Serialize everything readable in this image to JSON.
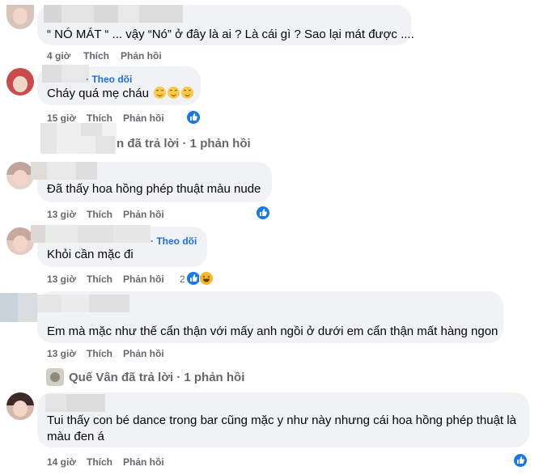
{
  "comments": [
    {
      "text": "“ NÓ MÁT “ ... vậy “Nó” ở đây là ai ? Là cái gì ? Sao lại mát được ....",
      "time": "4 giờ",
      "like": "Thích",
      "reply": "Phản hồi"
    },
    {
      "follow": "· Theo dõi",
      "text": "Cháy quá mẹ cháu",
      "time": "15 giờ",
      "like": "Thích",
      "reply": "Phản hồi",
      "reaction_icons": [
        "like-icon"
      ]
    },
    {
      "text": "Đã thấy hoa hồng phép thuật màu nude",
      "time": "13 giờ",
      "like": "Thích",
      "reply": "Phản hồi",
      "reaction_icons": [
        "like-icon"
      ]
    },
    {
      "follow": "· Theo dõi",
      "text": "Khỏi cần mặc đi",
      "time": "13 giờ",
      "like": "Thích",
      "reply": "Phản hồi",
      "reaction_count": "2",
      "reaction_icons": [
        "like-icon",
        "haha-icon"
      ]
    },
    {
      "text": "Em mà mặc như thế cẩn thận với mấy anh ngồi ở dưới em cẩn thận mất hàng ngon",
      "time": "13 giờ",
      "like": "Thích",
      "reply": "Phản hồi"
    },
    {
      "text_line1": "Tui thấy con bé dance trong bar cũng mặc y như này nhưng cái hoa hồng phép thuật là",
      "text_line2": "màu đen á",
      "time": "14 giờ",
      "like": "Thích",
      "reply": "Phản hồi",
      "reaction_icons": [
        "like-icon"
      ]
    }
  ],
  "replies_1": {
    "name_suffix": "n đã trả lời",
    "count": "· 1 phản hồi"
  },
  "replies_2": {
    "name": "Quế Vân đã trả lời",
    "count": "· 1 phản hồi"
  },
  "colors": {
    "link": "#216fdb",
    "meta": "#65676b",
    "bubble": "#f0f2f5",
    "like": "#1877f2"
  }
}
